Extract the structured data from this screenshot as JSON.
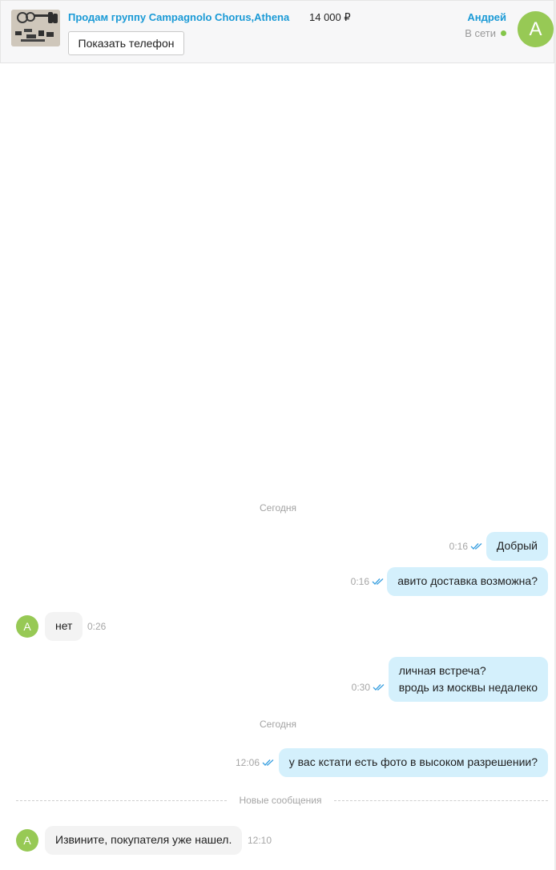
{
  "header": {
    "ad_title": "Продам группу Campagnolo Chorus,Athena",
    "price": "14 000 ₽",
    "show_phone_label": "Показать телефон",
    "user_name": "Андрей",
    "user_status": "В сети",
    "avatar_letter": "А",
    "thumb_icon": "product-photo-icon"
  },
  "colors": {
    "accent": "#1a9ad6",
    "online": "#84c64a",
    "avatar_bg": "#97c955",
    "outgoing_bubble": "#d4f0fc",
    "incoming_bubble": "#f3f3f3",
    "read_ticks": "#3aa0e0"
  },
  "chat": {
    "day_label_1": "Сегодня",
    "day_label_2": "Сегодня",
    "new_messages_label": "Новые сообщения",
    "avatar_letter": "А",
    "messages": [
      {
        "direction": "out",
        "lines": [
          "Добрый"
        ],
        "time": "0:16",
        "read": true
      },
      {
        "direction": "out",
        "lines": [
          "авито доставка возможна?"
        ],
        "time": "0:16",
        "read": true
      },
      {
        "direction": "in",
        "lines": [
          "нет"
        ],
        "time": "0:26"
      },
      {
        "direction": "out",
        "lines": [
          "личная встреча?",
          "вродь из москвы недалеко"
        ],
        "time": "0:30",
        "read": true
      },
      {
        "direction": "out",
        "lines": [
          "у вас кстати есть фото в высоком разрешении?"
        ],
        "time": "12:06",
        "read": true
      },
      {
        "direction": "in",
        "lines": [
          "Извините, покупателя уже нашел."
        ],
        "time": "12:10"
      }
    ]
  }
}
